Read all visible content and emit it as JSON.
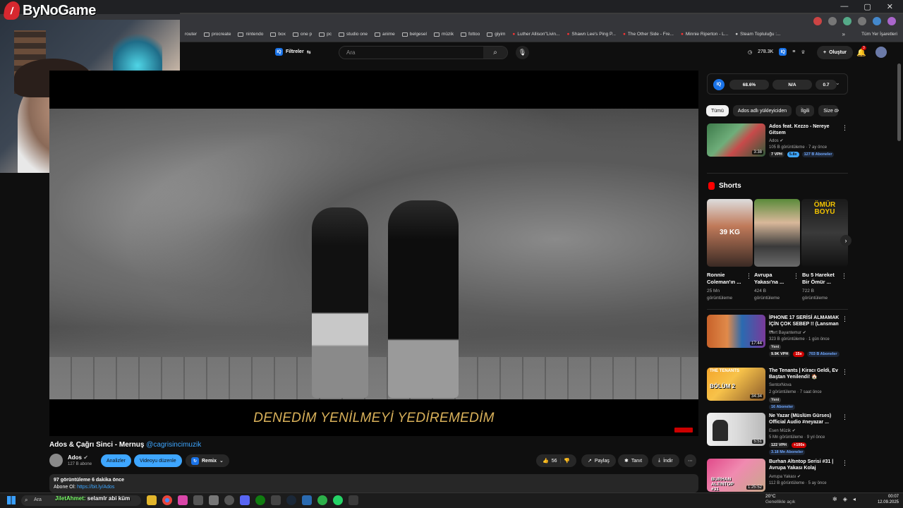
{
  "window": {
    "controls": [
      "—",
      "▢",
      "✕"
    ]
  },
  "bookmarks": {
    "items": [
      "router",
      "procreate",
      "nintendo",
      "box",
      "one p",
      "pc",
      "studio one",
      "anime",
      "belgesel",
      "müzik",
      "fottoo",
      "giyim",
      "Luther Allison\"Livin...",
      "Shawn Lee's Ping P...",
      "The Other Side - Fre...",
      "Minnie Riperton - L...",
      "Steam Topluluğu :..."
    ],
    "all_label": "Tüm Yer İşaretleri"
  },
  "overlay": {
    "logo_text": "ByNoGame",
    "logo_mark": "/"
  },
  "header": {
    "filter_label": "Filtreler",
    "iq": "IQ",
    "search_placeholder": "Ara",
    "subscriber_stat": "278.3K",
    "create_label": "Oluştur",
    "notif_count": "3"
  },
  "player": {
    "subtitle": "DENEDİM YENİLMEYİ YEDİREMEDİM"
  },
  "video": {
    "title": "Ados & Çağrı Sinci - Mernuş",
    "tag": "@cagrisincimuzik",
    "channel": "Ados",
    "channel_subs": "127 B abone",
    "analytics_label": "Analizler",
    "edit_label": "Videoyu düzenle",
    "remix_label": "Remix",
    "likes": "56",
    "share_label": "Paylaş",
    "promote_label": "Tanıt",
    "download_label": "İndir",
    "description_line1": "97 görüntüleme  6 dakika önce",
    "description_line2_prefix": "Abone Ol: ",
    "description_link": "https://bit.ly/Ados"
  },
  "iq_panel": {
    "label": "IQ",
    "stat1": "68.6%",
    "stat2": "N/A",
    "stat3": "0.7"
  },
  "chips": [
    "Tümü",
    "Ados adlı yükleyiciden",
    "İlgili",
    "Size ö"
  ],
  "sidebar_video_1": {
    "title": "Ados feat. Kezzo - Nereye Gitsem",
    "channel": "Ados",
    "meta": "105 B görüntüleme · 7 ay önce",
    "duration": "3:38",
    "vph": "7 VPH",
    "ratio": "5.8x",
    "subs": "127 B Aboneler"
  },
  "shorts": {
    "heading": "Shorts",
    "items": [
      {
        "title": "Ronnie Coleman'ın ...",
        "meta1": "25 Mn",
        "meta2": "görüntüleme",
        "overlay": "39 KG"
      },
      {
        "title": "Avrupa Yakası'na ...",
        "meta1": "424 B",
        "meta2": "görüntüleme",
        "overlay": ""
      },
      {
        "title": "Bu 5 Hareket Bir Ömür ...",
        "meta1": "722 B",
        "meta2": "görüntüleme",
        "overlay": "ÖMÜR BOYU"
      }
    ]
  },
  "sidebar_video_2": {
    "title": "İPHONE 17 SERİSİ ALMAMAK İÇİN ÇOK SEBEP !! (Lansman ...",
    "channel": "Mert Bayantemur",
    "meta": "323 B görüntüleme · 1 gün önce",
    "badge": "Yeni",
    "duration": "17:44",
    "vph": "9.9K VPH",
    "ratio": "15x",
    "subs": "703 B Aboneler"
  },
  "sidebar_video_3": {
    "title": "The Tenants | Kiracı Geldi, Ev Baştan Yenilendi! 🏠",
    "channel": "SentorNova",
    "meta": "2 görüntüleme · 7 saat önce",
    "badge": "Yeni",
    "duration": "34:34",
    "thumb_text": "BÖLÜM 2",
    "thumb_top": "THE TENANTS",
    "subs": "16 Aboneler"
  },
  "sidebar_video_4": {
    "title": "Ne Yazar (Müslüm Gürses) Official Audio #neyazar ...",
    "channel": "Esen Müzik",
    "meta": "5 Mn görüntüleme · 9 yıl önce",
    "duration": "5:51",
    "vph": "122 VPH",
    "ratio": "+100x",
    "subs": "3.18 Mn Aboneler"
  },
  "sidebar_video_5": {
    "title": "Burhan Altıntop Serisi #31 | Avrupa Yakası Kolaj",
    "channel": "Avrupa Yakası",
    "meta": "112 B görüntüleme · 5 ay önce",
    "duration": "1:25:52",
    "thumb_text": "BURHAN ALTINTOP #31"
  },
  "taskbar": {
    "search_label": "Ara",
    "chat_user": "JiletAhmet:",
    "chat_msg": " selamlr abi küm",
    "weather_temp": "20°C",
    "weather_desc": "Genellikle açık",
    "time": "00:07",
    "date": "12.09.2025"
  }
}
